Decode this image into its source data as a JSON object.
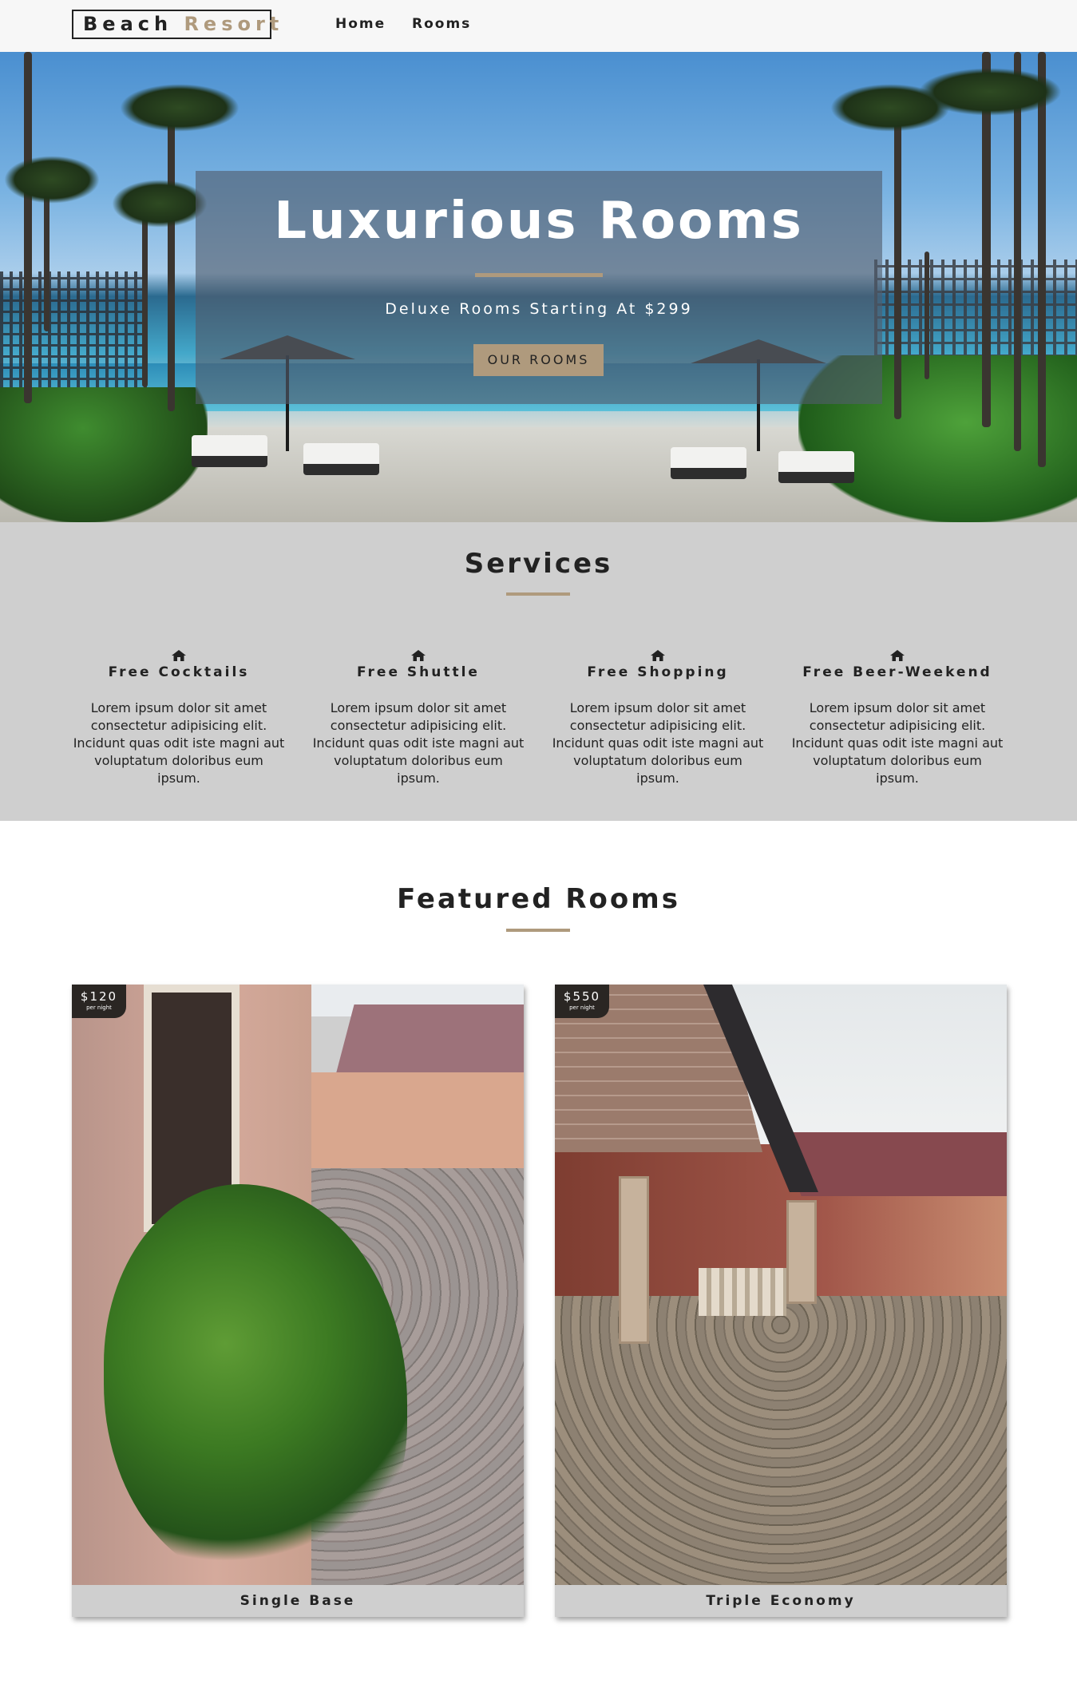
{
  "nav": {
    "logo_word1": "Beach",
    "logo_word2": "Resort",
    "links": [
      "Home",
      "Rooms"
    ]
  },
  "hero": {
    "title": "Luxurious Rooms",
    "subtitle": "Deluxe Rooms Starting At $299",
    "button_label": "OUR ROOMS"
  },
  "services": {
    "title": "Services",
    "items": [
      {
        "icon": "home-icon",
        "title": "Free Cocktails",
        "text": "Lorem ipsum dolor sit amet consectetur adipisicing elit. Incidunt quas odit iste magni aut voluptatum doloribus eum ipsum."
      },
      {
        "icon": "home-icon",
        "title": "Free Shuttle",
        "text": "Lorem ipsum dolor sit amet consectetur adipisicing elit. Incidunt quas odit iste magni aut voluptatum doloribus eum ipsum."
      },
      {
        "icon": "home-icon",
        "title": "Free Shopping",
        "text": "Lorem ipsum dolor sit amet consectetur adipisicing elit. Incidunt quas odit iste magni aut voluptatum doloribus eum ipsum."
      },
      {
        "icon": "home-icon",
        "title": "Free Beer-Weekend",
        "text": "Lorem ipsum dolor sit amet consectetur adipisicing elit. Incidunt quas odit iste magni aut voluptatum doloribus eum ipsum."
      }
    ]
  },
  "featured": {
    "title": "Featured Rooms",
    "rooms": [
      {
        "name": "Single Base",
        "price": "$120",
        "per": "per night"
      },
      {
        "name": "Triple Economy",
        "price": "$550",
        "per": "per night"
      }
    ]
  },
  "colors": {
    "accent": "#af9a7d",
    "nav_bg": "#f7f7f7",
    "services_bg": "#cfcfcf",
    "text": "#222222"
  }
}
